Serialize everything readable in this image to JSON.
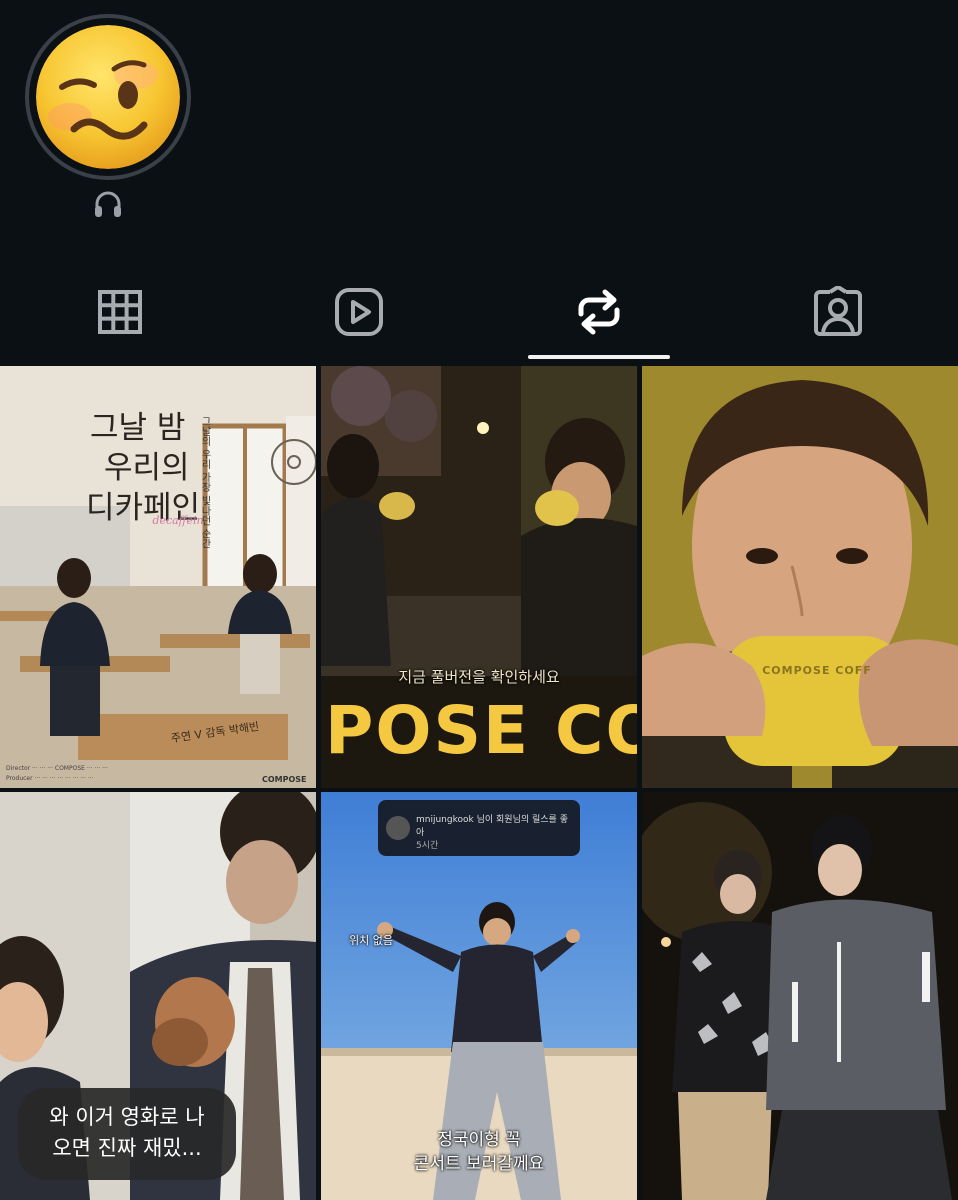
{
  "profile": {
    "avatar": "woozy-face-emoji",
    "note_icon": "headphones-icon"
  },
  "tabs": [
    {
      "name": "posts",
      "icon": "grid-icon",
      "active": false
    },
    {
      "name": "reels",
      "icon": "reels-play-icon",
      "active": false
    },
    {
      "name": "reposts",
      "icon": "repost-icon",
      "active": true
    },
    {
      "name": "tagged",
      "icon": "tagged-person-icon",
      "active": false
    }
  ],
  "posts": {
    "poster": {
      "title_lines": [
        "그날 밤",
        "우리의",
        "디카페인"
      ],
      "script_sub": "decaffein",
      "side_text": "그날의 우리 가장 빛나던 순간",
      "credit_brand": "COMPOSE",
      "desk_label": "주연 V   감독 박해빈"
    },
    "cafe_scene": {
      "caption": "지금 풀버전을 확인하세요",
      "brand_text": "IPOSE CO"
    },
    "cup_closeup": {
      "cup_text": "COMPOSE COFF"
    },
    "reel_notification": {
      "username": "mnijungkook",
      "message": "님이 회원님의 릴스를 좋아",
      "time": "5시간",
      "extra": "위치 없음"
    },
    "reel_subtitle": [
      "정국이형 꼭",
      "콘서트 보러갈께요"
    ]
  },
  "comment": {
    "lines": [
      "와 이거 영화로 나",
      "오면 진짜 재밌..."
    ]
  },
  "colors": {
    "background": "#0b1014",
    "active_indicator": "#f2f2f2",
    "emoji_yellow": "#f7c531"
  }
}
